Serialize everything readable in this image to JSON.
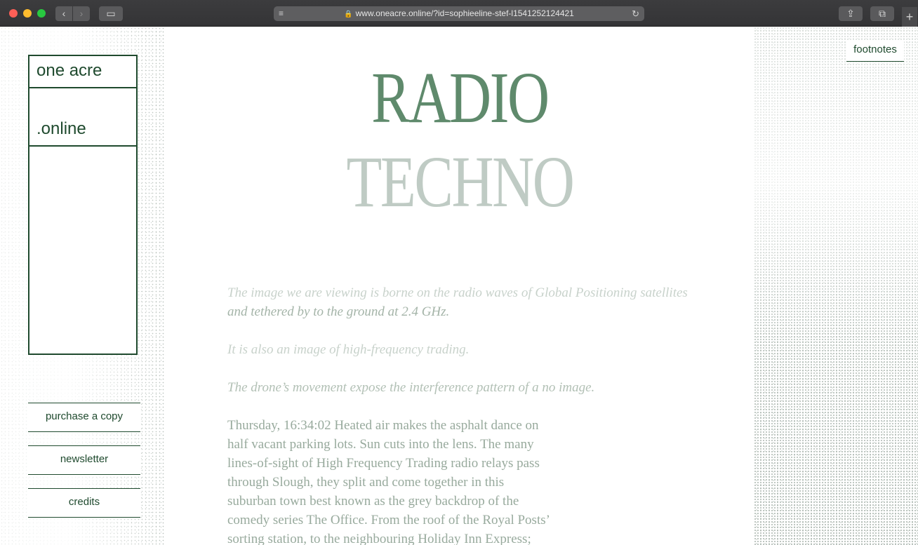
{
  "browser": {
    "url": "www.oneacre.online/?id=sophieeline-stef-l1541252124421",
    "back_glyph": "‹",
    "forward_glyph": "›",
    "sidebar_glyph": "▭",
    "reader_glyph": "≡",
    "lock_glyph": "🔒",
    "reload_glyph": "↻",
    "share_glyph": "⇪",
    "tabs_glyph": "⧉",
    "new_tab_glyph": "+"
  },
  "logo": {
    "line1": "one acre",
    "line2": ".online"
  },
  "nav": {
    "purchase": "purchase a copy",
    "newsletter": "newsletter",
    "credits": "credits",
    "footnotes": "footnotes"
  },
  "title": {
    "line1": "RADIO",
    "line2": "TECHNO"
  },
  "article": {
    "intro_1a": "The image we are viewing is borne on the radio waves of Global Positioning satellites",
    "intro_1b": "and tethered by to the ground at 2.4 GHz.",
    "intro_2": "It is also an image of high-frequency trading.",
    "intro_3": "The drone’s movement expose the interference pattern of a no image.",
    "body": "Thursday, 16:34:02 Heated air makes the asphalt dance on half vacant parking lots. Sun cuts into the lens. The many lines-of-sight of High Frequency Trading radio relays pass through Slough, they split and come together in this suburban town best known as the grey backdrop of the comedy series The Office. From the roof of the Royal Posts’ sorting station, to the neighbouring Holiday Inn Express;"
  },
  "colors": {
    "brand_green": "#1f4a2e",
    "title_green": "#5f8a6c"
  }
}
